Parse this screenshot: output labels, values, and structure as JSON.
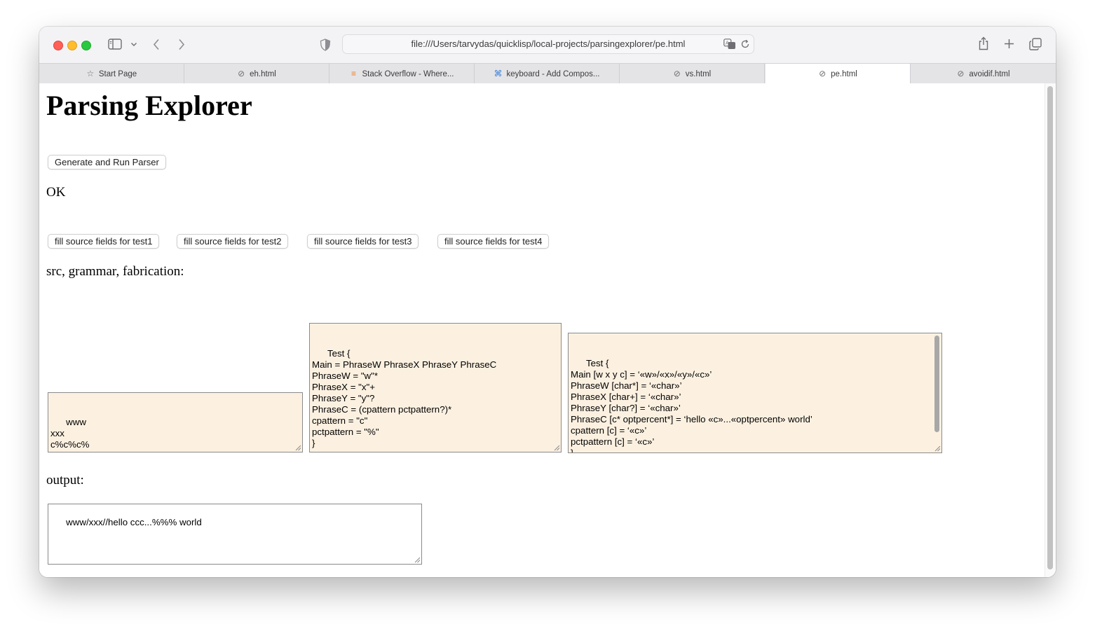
{
  "browser": {
    "url": "file:///Users/tarvydas/quicklisp/local-projects/parsingexplorer/pe.html",
    "tabs": [
      {
        "label": "Start Page",
        "icon": "star-icon"
      },
      {
        "label": "eh.html",
        "icon": "compass-icon"
      },
      {
        "label": "Stack Overflow - Where...",
        "icon": "stackoverflow-icon"
      },
      {
        "label": "keyboard - Add Compos...",
        "icon": "command-icon"
      },
      {
        "label": "vs.html",
        "icon": "compass-icon"
      },
      {
        "label": "pe.html",
        "icon": "compass-icon",
        "active": true
      },
      {
        "label": "avoidif.html",
        "icon": "compass-icon"
      }
    ]
  },
  "page": {
    "title": "Parsing Explorer",
    "run_button": "Generate and Run Parser",
    "status": "OK",
    "test_buttons": [
      "fill source fields for test1",
      "fill source fields for test2",
      "fill source fields for test3",
      "fill source fields for test4"
    ],
    "src_label": "src, grammar, fabrication:",
    "src_text": "www\nxxx\nc%c%c%",
    "grammar_text": "Test {\nMain = PhraseW PhraseX PhraseY PhraseC\nPhraseW = \"w\"*\nPhraseX = \"x\"+\nPhraseY = \"y\"?\nPhraseC = (cpattern pctpattern?)*\ncpattern = \"c\"\npctpattern = \"%\"\n}",
    "fabrication_text": "Test {\nMain [w x y c] = ‘«w»/«x»/«y»/«c»’\nPhraseW [char*] = ‘«char»’\nPhraseX [char+] = ‘«char»’\nPhraseY [char?] = ‘«char»’\nPhraseC [c* optpercent*] = ‘hello «c»...«optpercent» world’\ncpattern [c] = ‘«c»’\npctpattern [c] = ‘«c»’\n}",
    "output_label": "output:",
    "output_text": "www/xxx//hello ccc...%%% world"
  }
}
